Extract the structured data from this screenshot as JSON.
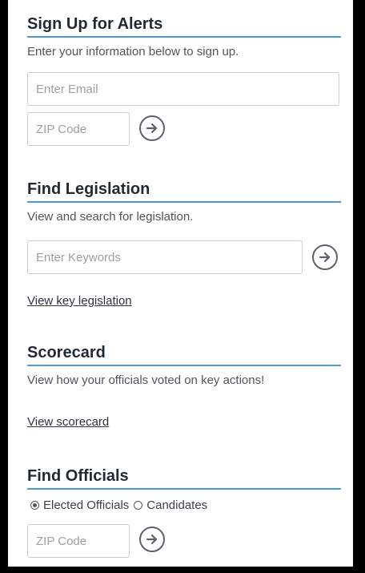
{
  "alerts": {
    "heading": "Sign Up for Alerts",
    "description": "Enter your information below to sign up.",
    "email_placeholder": "Enter Email",
    "zip_placeholder": "ZIP Code"
  },
  "legislation": {
    "heading": "Find Legislation",
    "description": "View and search for legislation.",
    "keywords_placeholder": "Enter Keywords",
    "link": "View key legislation"
  },
  "scorecard": {
    "heading": "Scorecard",
    "description": "View how your officials voted on key actions!",
    "link": "View scorecard"
  },
  "officials": {
    "heading": "Find Officials",
    "options": [
      {
        "label": "Elected Officials",
        "selected": true
      },
      {
        "label": "Candidates",
        "selected": false
      }
    ],
    "zip_placeholder": "ZIP Code"
  },
  "colors": {
    "accent_rule": "#4a9ad6",
    "heading_text": "#1f2a36",
    "background_frame": "#000000"
  },
  "icons": {
    "go": "arrow-right-circle-icon"
  }
}
